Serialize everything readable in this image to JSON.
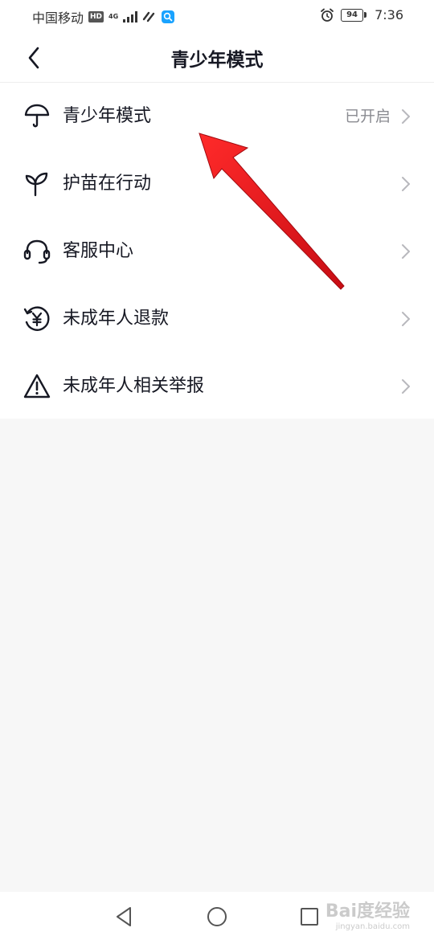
{
  "status_bar": {
    "carrier": "中国移动",
    "hd_badge": "HD",
    "network": "4G",
    "battery": "94",
    "time": "7:36"
  },
  "header": {
    "title": "青少年模式"
  },
  "menu": [
    {
      "label": "青少年模式",
      "value": "已开启",
      "icon": "umbrella-icon"
    },
    {
      "label": "护苗在行动",
      "value": "",
      "icon": "sprout-icon"
    },
    {
      "label": "客服中心",
      "value": "",
      "icon": "headset-icon"
    },
    {
      "label": "未成年人退款",
      "value": "",
      "icon": "yuan-refund-icon"
    },
    {
      "label": "未成年人相关举报",
      "value": "",
      "icon": "warning-icon"
    }
  ],
  "colors": {
    "accent_arrow": "#e8121b",
    "text_primary": "#161823",
    "text_secondary": "#8a8b91",
    "background": "#f7f7f7"
  },
  "watermark": {
    "brand": "Bai度经验",
    "url": "jingyan.baidu.com"
  }
}
